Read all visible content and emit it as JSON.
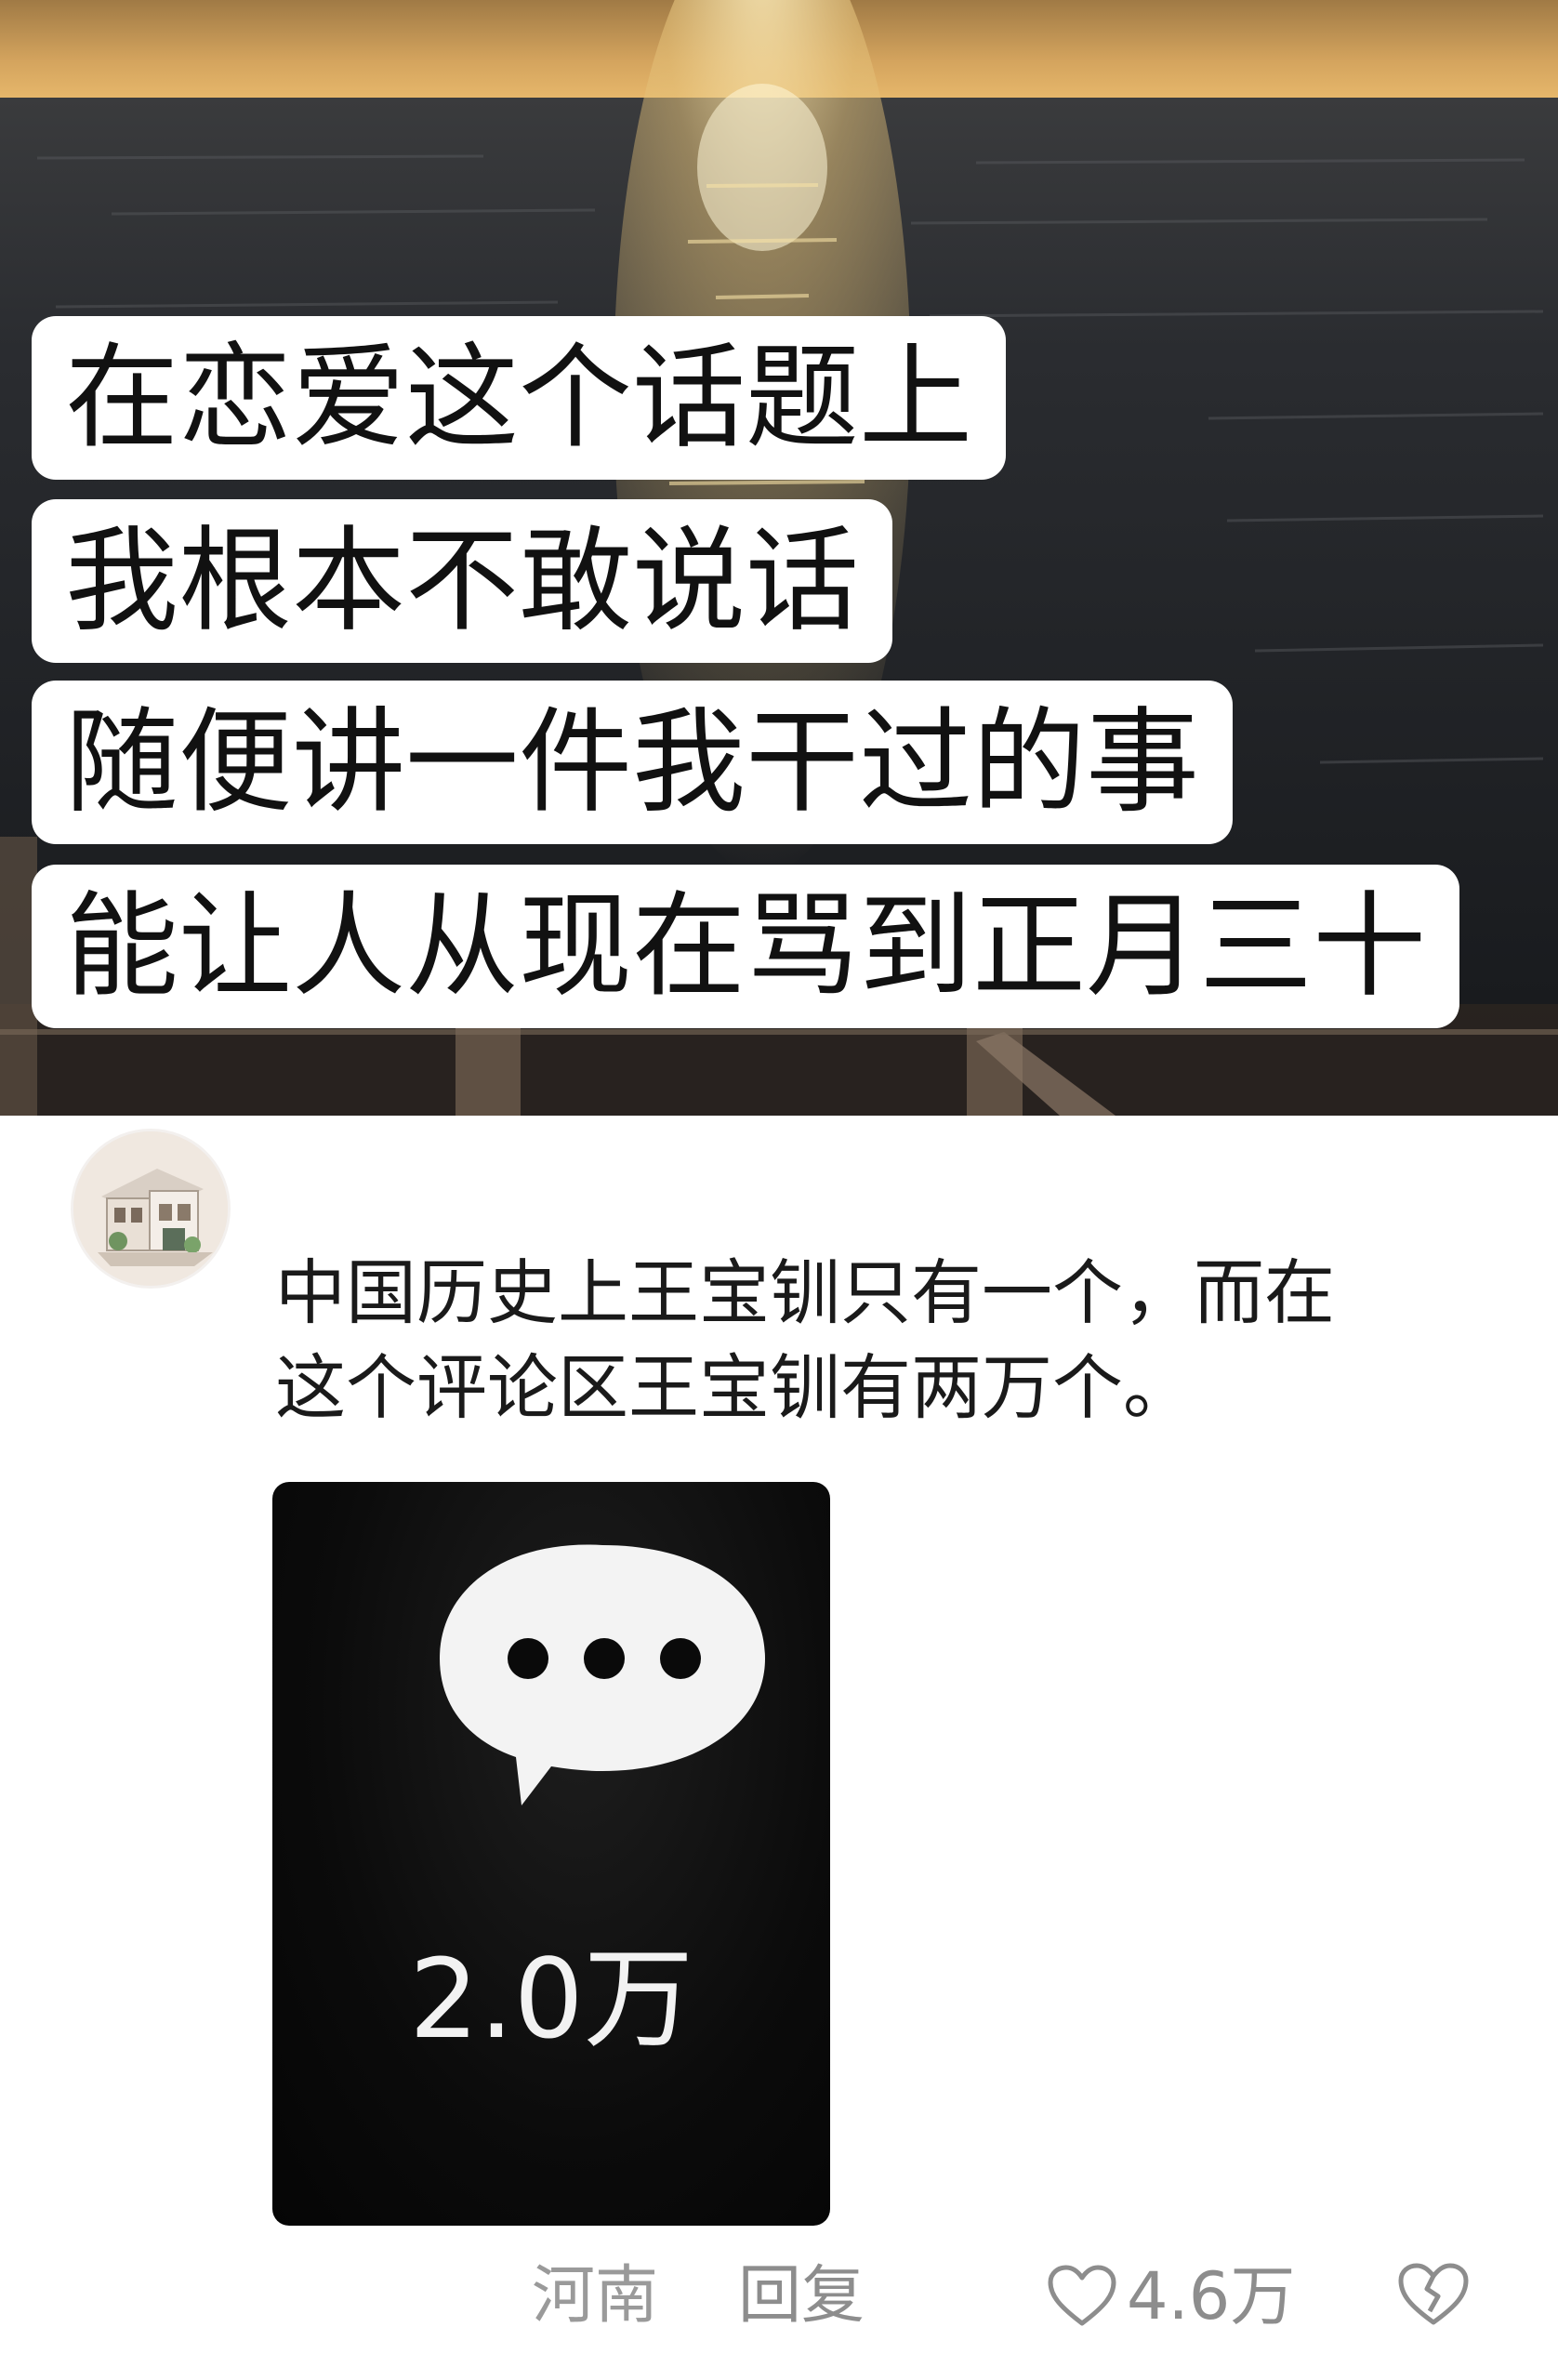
{
  "post": {
    "caption_lines": [
      "在恋爱这个话题上",
      "我根本不敢说话",
      "随便讲一件我干过的事",
      "能让人从现在骂到正月三十"
    ]
  },
  "comment": {
    "avatar_icon": "house-illustration-avatar",
    "text_lines": [
      "中国历史上王宝钏只有一个，而在",
      "这个评论区王宝钏有两万个。"
    ],
    "attached_image": {
      "icon": "chat-bubble-ellipsis-icon",
      "count": "2.0万"
    },
    "location": "河南",
    "reply_label": "回复",
    "like_count": "4.6万"
  }
}
